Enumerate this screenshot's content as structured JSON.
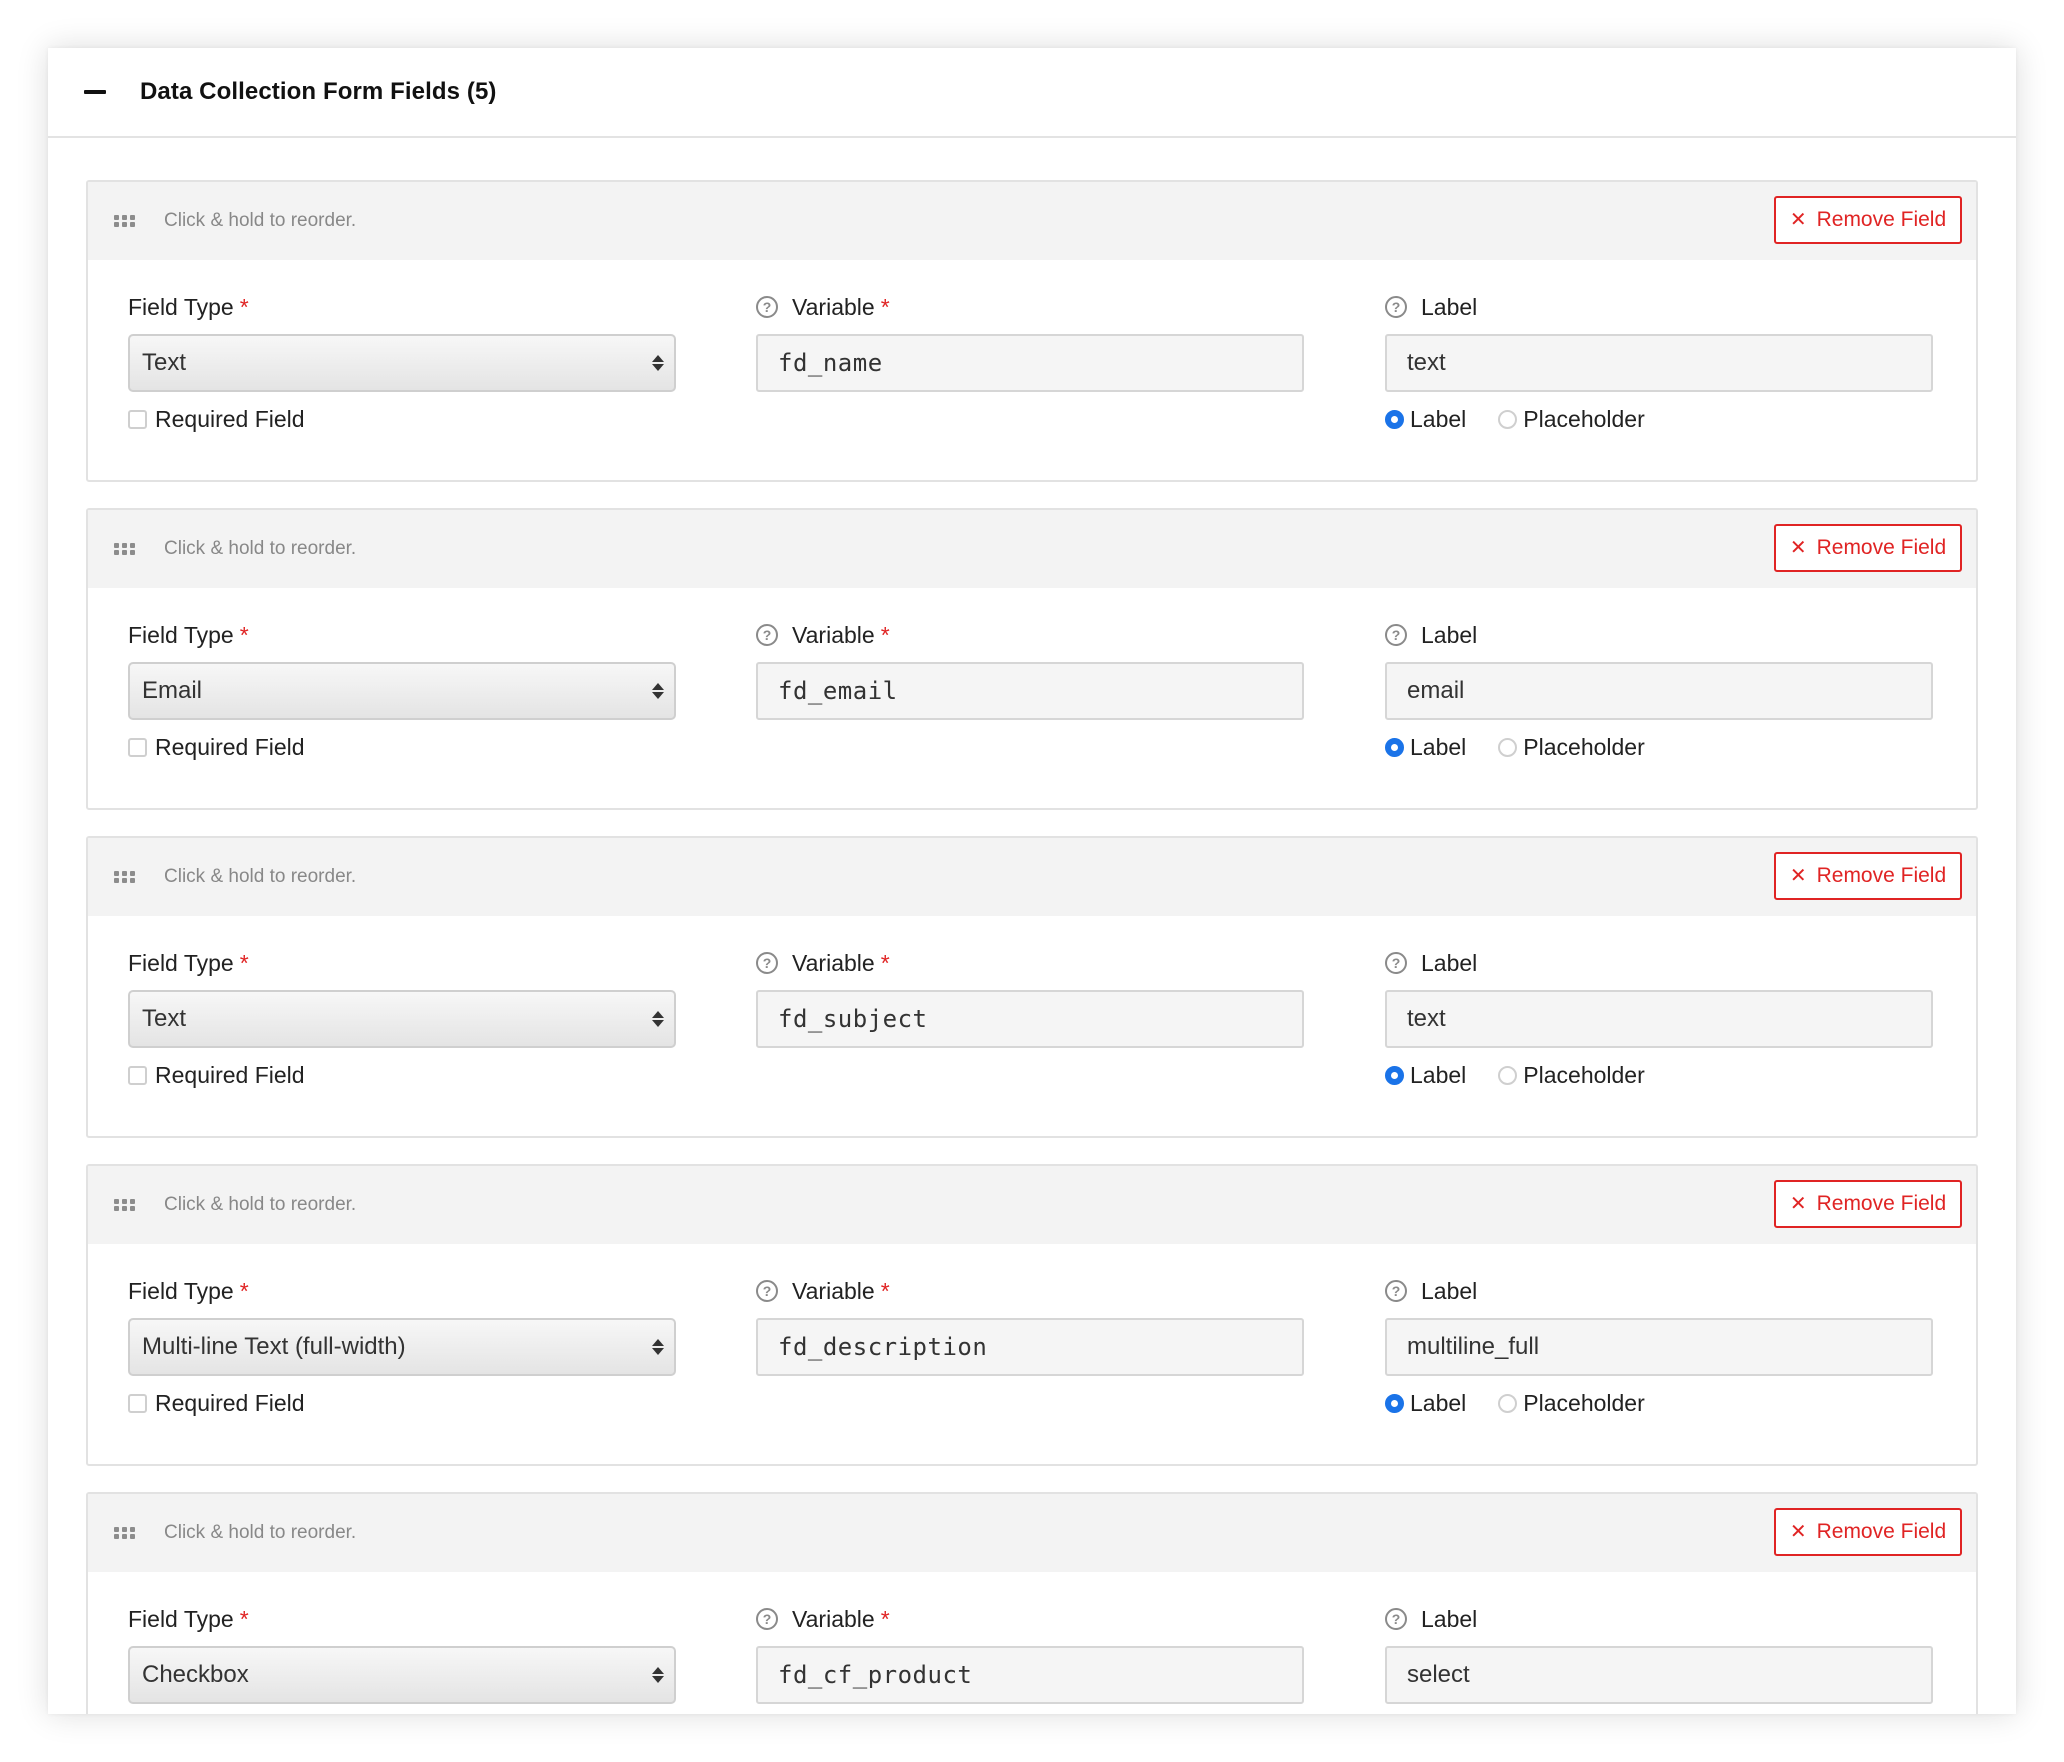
{
  "panel": {
    "title": "Data Collection Form Fields (5)"
  },
  "labels": {
    "reorder_hint": "Click & hold to reorder.",
    "remove_button": "Remove Field",
    "field_type": "Field Type",
    "variable": "Variable",
    "label": "Label",
    "required_field": "Required Field",
    "radio_label": "Label",
    "radio_placeholder": "Placeholder",
    "required_marker": "*"
  },
  "fields": [
    {
      "type": "Text",
      "variable": "fd_name",
      "label": "text",
      "required": false,
      "display_mode": "Label"
    },
    {
      "type": "Email",
      "variable": "fd_email",
      "label": "email",
      "required": false,
      "display_mode": "Label"
    },
    {
      "type": "Text",
      "variable": "fd_subject",
      "label": "text",
      "required": false,
      "display_mode": "Label"
    },
    {
      "type": "Multi-line Text (full-width)",
      "variable": "fd_description",
      "label": "multiline_full",
      "required": false,
      "display_mode": "Label"
    },
    {
      "type": "Checkbox",
      "variable": "fd_cf_product",
      "label": "select",
      "required": false,
      "display_mode": "Label"
    }
  ],
  "colors": {
    "accent_red": "#e02424",
    "radio_blue": "#1a73e8"
  }
}
